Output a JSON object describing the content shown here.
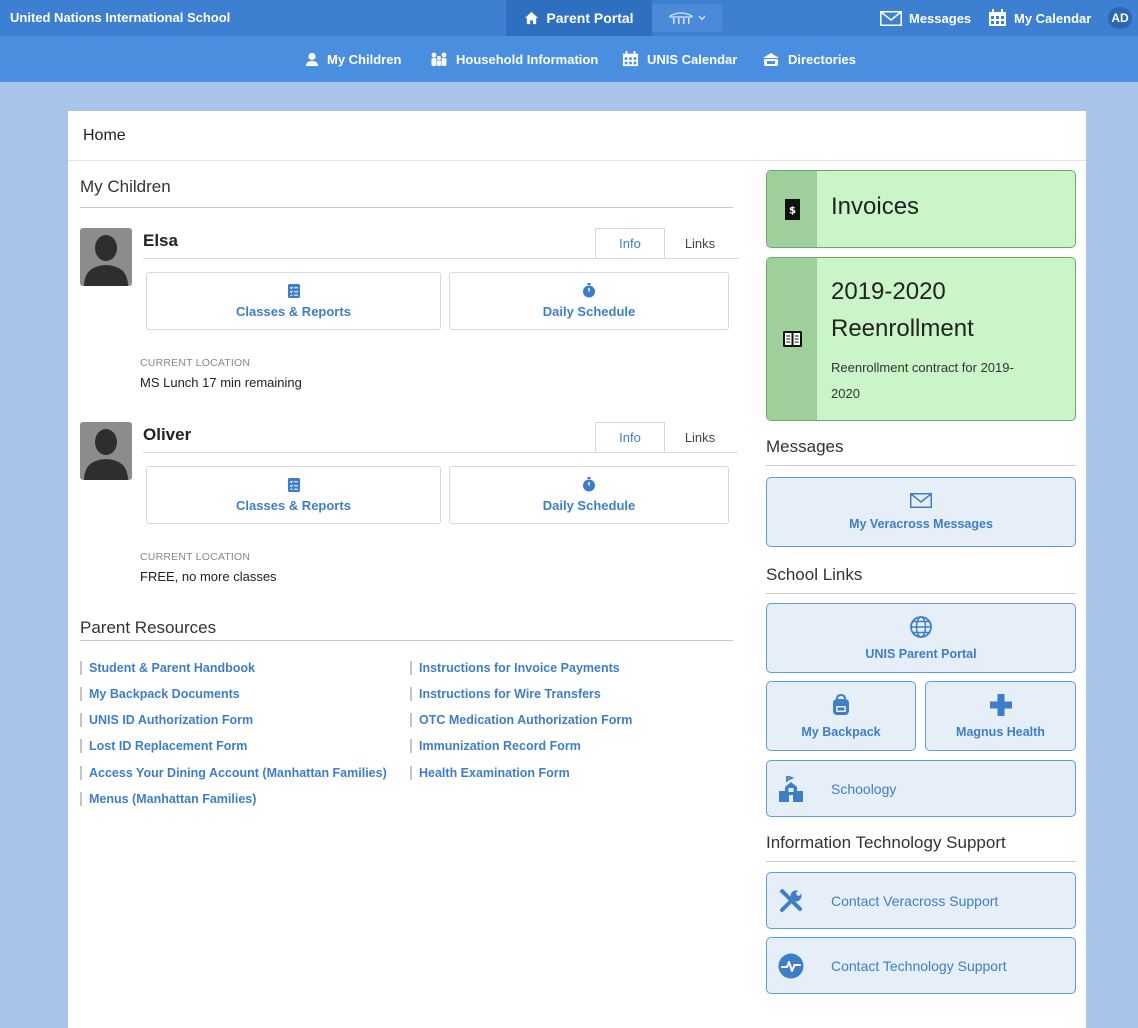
{
  "header": {
    "school_name": "United Nations International School",
    "portal_label": "Parent Portal",
    "messages_label": "Messages",
    "calendar_label": "My Calendar",
    "user_initials": "AD"
  },
  "nav": {
    "items": [
      {
        "label": "My Children",
        "icon": "person-icon"
      },
      {
        "label": "Household Information",
        "icon": "family-icon"
      },
      {
        "label": "UNIS Calendar",
        "icon": "calendar-icon"
      },
      {
        "label": "Directories",
        "icon": "directory-icon"
      }
    ]
  },
  "breadcrumb": "Home",
  "my_children": {
    "title": "My Children",
    "children": [
      {
        "name": "Elsa",
        "tabs": [
          "Info",
          "Links"
        ],
        "buttons": [
          "Classes & Reports",
          "Daily Schedule"
        ],
        "location_label": "CURRENT LOCATION",
        "location": "MS Lunch 17 min remaining"
      },
      {
        "name": "Oliver",
        "tabs": [
          "Info",
          "Links"
        ],
        "buttons": [
          "Classes & Reports",
          "Daily Schedule"
        ],
        "location_label": "CURRENT LOCATION",
        "location": "FREE, no more classes"
      }
    ]
  },
  "parent_resources": {
    "title": "Parent Resources",
    "left": [
      "Student & Parent Handbook",
      "My Backpack Documents",
      "UNIS ID Authorization Form",
      "Lost ID Replacement Form",
      "Access Your Dining Account (Manhattan Families)",
      "Menus (Manhattan Families)"
    ],
    "right": [
      "Instructions for Invoice Payments",
      "Instructions for Wire Transfers",
      "OTC Medication Authorization Form",
      "Immunization Record Form",
      "Health Examination Form"
    ]
  },
  "sidebar": {
    "invoices": {
      "title": "Invoices"
    },
    "reenrollment": {
      "title_line1": "2019-2020",
      "title_line2": "Reenrollment",
      "desc_line1": "Reenrollment contract for 2019-",
      "desc_line2": "2020"
    },
    "messages": {
      "title": "Messages",
      "tile_label": "My Veracross Messages"
    },
    "school_links": {
      "title": "School Links",
      "portal": "UNIS Parent Portal",
      "backpack": "My Backpack",
      "magnus": "Magnus Health",
      "schoology": "Schoology"
    },
    "it_support": {
      "title": "Information Technology Support",
      "veracross": "Contact Veracross Support",
      "tech": "Contact Technology Support"
    }
  },
  "colors": {
    "top_bar": "#3d7fd0",
    "nav_bar": "#4a8ee0",
    "link": "#3e7ec9",
    "green_tile": "#c9f5c8",
    "page_bg": "#a8c4ea"
  }
}
